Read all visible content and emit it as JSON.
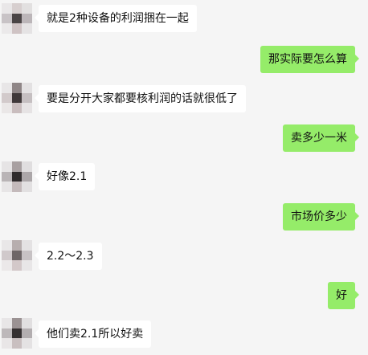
{
  "chat": {
    "messages": [
      {
        "side": "in",
        "text": "就是2种设备的利润捆在一起"
      },
      {
        "side": "out",
        "text": "那实际要怎么算"
      },
      {
        "side": "in",
        "text": "要是分开大家都要核利润的话就很低了"
      },
      {
        "side": "out",
        "text": "卖多少一米"
      },
      {
        "side": "in",
        "text": "好像2.1"
      },
      {
        "side": "out",
        "text": "市场价多少"
      },
      {
        "side": "in",
        "text": "2.2～2.3"
      },
      {
        "side": "out",
        "text": "好"
      },
      {
        "side": "in",
        "text": "他们卖2.1所以好卖"
      }
    ]
  },
  "colors": {
    "background": "#f5f5f5",
    "incoming_bubble": "#ffffff",
    "outgoing_bubble": "#95ec69",
    "text": "#111111"
  }
}
